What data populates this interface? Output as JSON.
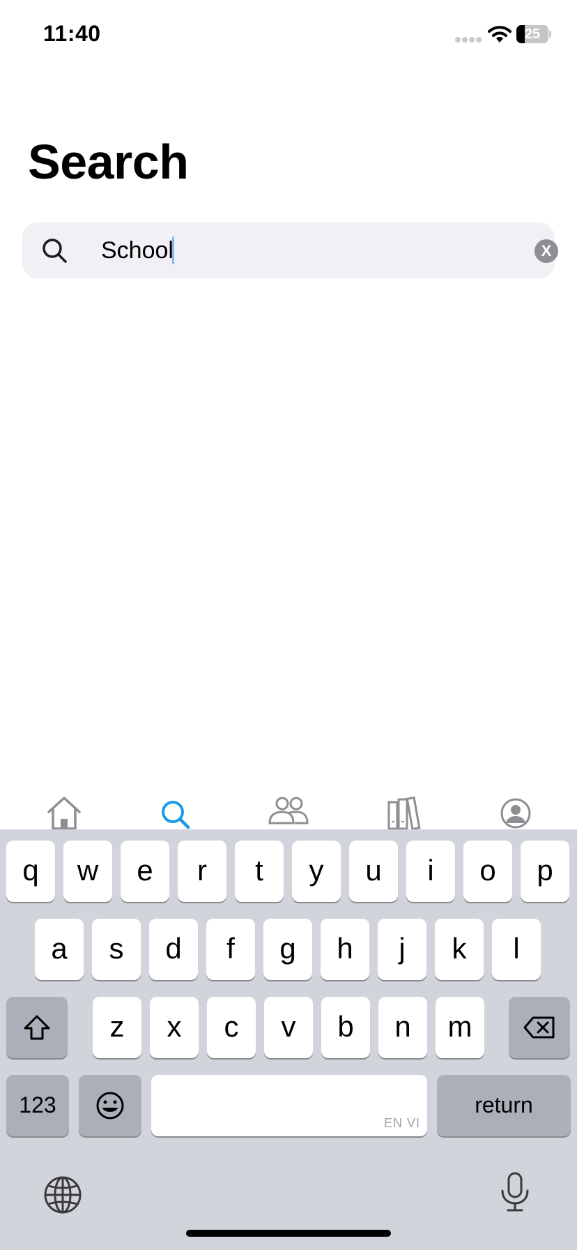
{
  "status_bar": {
    "time": "11:40",
    "battery_level": "25",
    "battery_fraction": 0.25,
    "icons": [
      "signal-icon",
      "wifi-icon",
      "battery-icon"
    ]
  },
  "page": {
    "title": "Search"
  },
  "search": {
    "value": "School",
    "icon": "search-icon",
    "clear_label": "X"
  },
  "tab_bar": {
    "active_color": "#1f9be3",
    "inactive_color": "#8e8e93",
    "tabs": [
      {
        "icon": "home-icon"
      },
      {
        "icon": "search-icon",
        "active": true
      },
      {
        "icon": "people-icon"
      },
      {
        "icon": "library-icon"
      },
      {
        "icon": "profile-icon"
      }
    ]
  },
  "keyboard": {
    "row1": [
      "q",
      "w",
      "e",
      "r",
      "t",
      "y",
      "u",
      "i",
      "o",
      "p"
    ],
    "row2": [
      "a",
      "s",
      "d",
      "f",
      "g",
      "h",
      "j",
      "k",
      "l"
    ],
    "row3": [
      "z",
      "x",
      "c",
      "v",
      "b",
      "n",
      "m"
    ],
    "numbers_label": "123",
    "return_label": "return",
    "space_language": "EN VI",
    "icons": [
      "shift-icon",
      "delete-icon",
      "emoji-icon",
      "globe-icon",
      "microphone-icon"
    ]
  }
}
